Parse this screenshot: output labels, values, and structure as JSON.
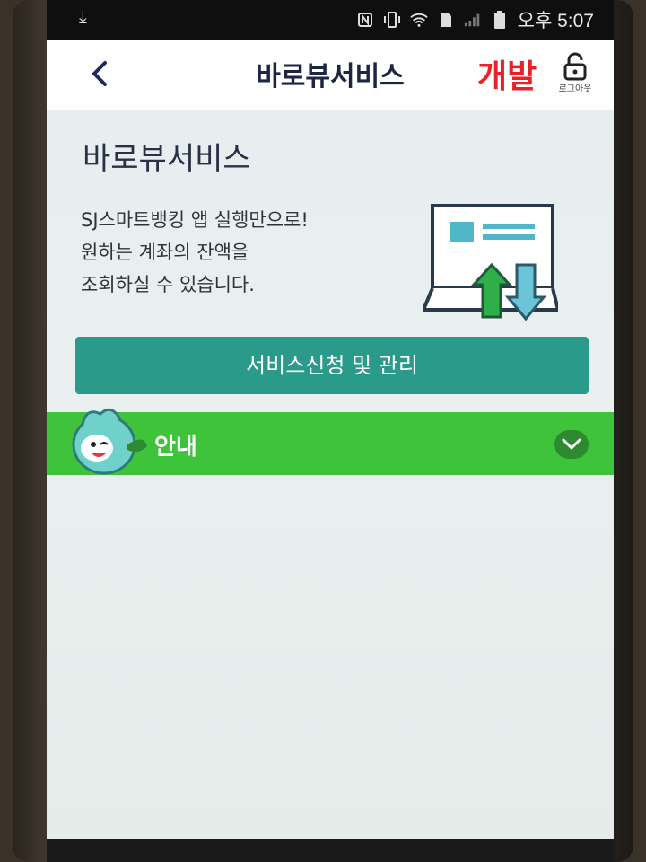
{
  "status_bar": {
    "time": "오후 5:07",
    "icons": [
      "download-icon",
      "nfc-icon",
      "vibrate-icon",
      "wifi-icon",
      "sim-icon",
      "signal-icon",
      "battery-icon"
    ]
  },
  "header": {
    "back_icon": "chevron-left-icon",
    "title": "바로뷰서비스",
    "dev_label": "개발",
    "logout_icon": "lock-icon",
    "logout_label": "로그아웃"
  },
  "main": {
    "section_title": "바로뷰서비스",
    "description": [
      "SJ스마트뱅킹 앱 실행만으로!",
      "원하는 계좌의 잔액을",
      "조회하실 수 있습니다."
    ],
    "service_button_label": "서비스신청 및 관리",
    "info": {
      "label": "안내",
      "toggle_icon": "chevron-down-icon",
      "expanded": false
    }
  },
  "colors": {
    "header_title": "#1e2540",
    "dev_label": "#e8222a",
    "service_button": "#2a9a8a",
    "info_bar": "#3ec33a"
  }
}
